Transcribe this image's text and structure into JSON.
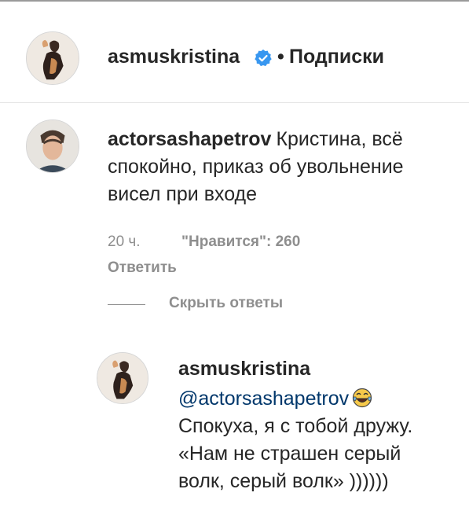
{
  "header": {
    "username": "asmuskristina",
    "separator": "•",
    "follow_label": "Подписки",
    "avatar_icon": "profile-photo-asmuskristina",
    "verified_icon": "verified-badge-icon",
    "verified_color": "#3897f0"
  },
  "comment": {
    "username": "actorsashapetrov",
    "text": "Кристина, всё спокойно, приказ об увольнение висел при входе",
    "time": "20 ч.",
    "likes": "\"Нравится\": 260",
    "reply_label": "Ответить",
    "avatar_icon": "profile-photo-actorsashapetrov"
  },
  "replies_toggle": {
    "label": "Скрыть ответы"
  },
  "reply": {
    "username": "asmuskristina",
    "mention": "@actorsashapetrov",
    "emoji_icon": "tears-of-joy-emoji",
    "line1": "Спокуха, я с тобой дружу.",
    "line2": "«Нам не страшен серый",
    "line3": "волк, серый волк» ))))))",
    "avatar_icon": "profile-photo-asmuskristina"
  },
  "colors": {
    "text": "#262626",
    "secondary": "#8e8e8e",
    "mention": "#00376b"
  }
}
